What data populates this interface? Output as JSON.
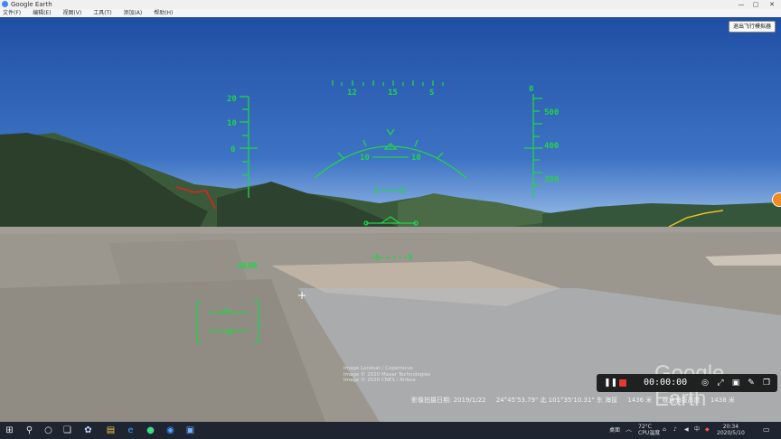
{
  "window": {
    "title": "Google Earth",
    "controls": [
      "—",
      "▢",
      "✕"
    ]
  },
  "menu": {
    "items": [
      "文件(F)",
      "编辑(E)",
      "视图(V)",
      "工具(T)",
      "添加(A)",
      "帮助(H)"
    ]
  },
  "flight": {
    "exit_label": "退出飞行模拟器"
  },
  "hud": {
    "color": "#22d34a",
    "left_scale": [
      "20",
      "10",
      "0"
    ],
    "heading": [
      "12",
      "15",
      "S"
    ],
    "right_top": "0",
    "right_scale": [
      "500",
      "400",
      "300"
    ],
    "pitch_upper_left": "10",
    "pitch_upper_right": "10",
    "pitch_mid_left": "5",
    "pitch_mid_right": "5",
    "pitch_low_left": "-5",
    "pitch_low_right": "-5",
    "gear": "GEAR"
  },
  "overlay": {
    "watermark": "Google Earth",
    "credits": [
      "Image Landsat / Copernicus",
      "Image © 2020 Maxar Technologies",
      "Image © 2020 CNES / Airbus"
    ],
    "status": [
      "影像拍摄日期: 2019/1/22",
      "24°45'53.79\" 北 101°35'10.31\" 东 海拔",
      "1436 米",
      "视角海拔高度",
      "1438 米"
    ]
  },
  "recorder": {
    "timer": "00:00:00"
  },
  "taskbar": {
    "tray_label": "桌面",
    "temp": "72°C",
    "temp_label": "CPU温度",
    "time": "20:34",
    "date": "2020/5/10"
  }
}
